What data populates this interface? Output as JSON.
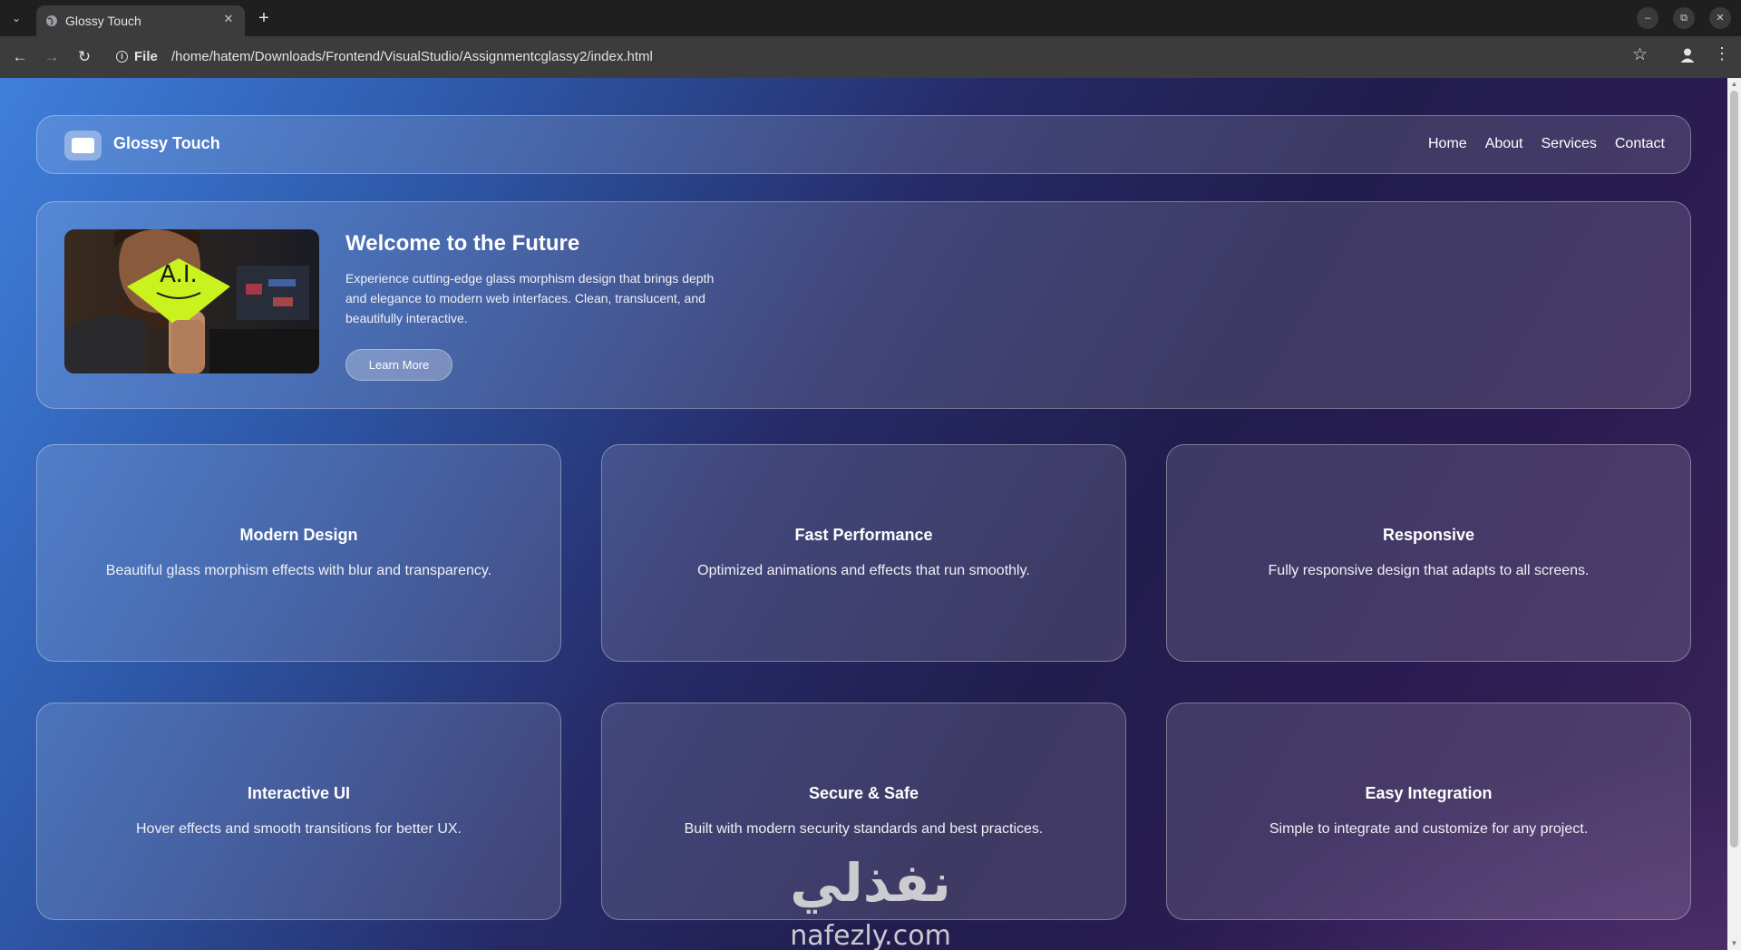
{
  "browser": {
    "tab_title": "Glossy Touch",
    "new_tab_label": "+",
    "address_scheme": "File",
    "address_url": "/home/hatem/Downloads/Frontend/VisualStudio/Assignmentcglassy2/index.html"
  },
  "page": {
    "nav": {
      "brand": "Glossy Touch",
      "links": [
        "Home",
        "About",
        "Services",
        "Contact"
      ]
    },
    "hero": {
      "image_sign_text": "A.I.",
      "title": "Welcome to the Future",
      "text": "Experience cutting-edge glass morphism design that brings depth and elegance to modern web interfaces. Clean, translucent, and beautifully interactive.",
      "button": "Learn More"
    },
    "cards": [
      {
        "title": "Modern Design",
        "text": "Beautiful glass morphism effects with blur and transparency."
      },
      {
        "title": "Fast Performance",
        "text": "Optimized animations and effects that run smoothly."
      },
      {
        "title": "Responsive",
        "text": "Fully responsive design that adapts to all screens."
      },
      {
        "title": "Interactive UI",
        "text": "Hover effects and smooth transitions for better UX."
      },
      {
        "title": "Secure & Safe",
        "text": "Built with modern security standards and best practices."
      },
      {
        "title": "Easy Integration",
        "text": "Simple to integrate and customize for any project."
      }
    ]
  },
  "watermark": {
    "arabic": "نفذلي",
    "latin": "nafezly.com"
  },
  "colors": {
    "background_left": "#3f7fdc",
    "background_mid": "#252a66",
    "background_right": "#3a2558",
    "text": "#ffffff"
  }
}
